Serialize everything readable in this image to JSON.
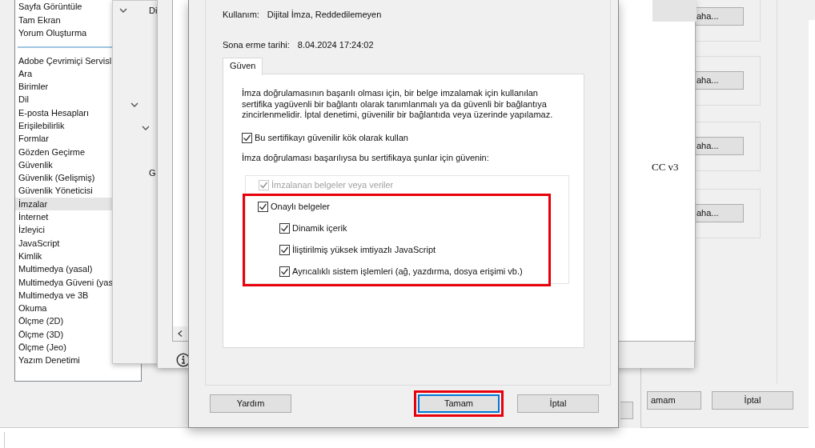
{
  "preferences_window": {
    "categories_top": [
      "Sayfa Görüntüle",
      "Tam Ekran",
      "Yorum Oluşturma"
    ],
    "categories": [
      {
        "label": "Adobe Çevrimiçi Servisl",
        "selected": false
      },
      {
        "label": "Ara",
        "selected": false
      },
      {
        "label": "Birimler",
        "selected": false
      },
      {
        "label": "Dil",
        "selected": false
      },
      {
        "label": "E-posta Hesapları",
        "selected": false
      },
      {
        "label": "Erişilebilirlik",
        "selected": false
      },
      {
        "label": "Formlar",
        "selected": false
      },
      {
        "label": "Gözden Geçirme",
        "selected": false
      },
      {
        "label": "Güvenlik",
        "selected": false
      },
      {
        "label": "Güvenlik (Gelişmiş)",
        "selected": false
      },
      {
        "label": "Güvenlik Yöneticisi",
        "selected": false
      },
      {
        "label": "İmzalar",
        "selected": true
      },
      {
        "label": "İnternet",
        "selected": false
      },
      {
        "label": "İzleyici",
        "selected": false
      },
      {
        "label": "JavaScript",
        "selected": false
      },
      {
        "label": "Kimlik",
        "selected": false
      },
      {
        "label": "Multimedya (yasal)",
        "selected": false
      },
      {
        "label": "Multimedya Güveni (yas",
        "selected": false
      },
      {
        "label": "Multimedya ve 3B",
        "selected": false
      },
      {
        "label": "Okuma",
        "selected": false
      },
      {
        "label": "Ölçme (2D)",
        "selected": false
      },
      {
        "label": "Ölçme (3D)",
        "selected": false
      },
      {
        "label": "Ölçme (Jeo)",
        "selected": false
      },
      {
        "label": "Yazım Denetimi",
        "selected": false
      }
    ],
    "more_buttons": [
      "aha...",
      "aha...",
      "aha...",
      "aha..."
    ],
    "buttons": [
      "amam",
      "İptal"
    ]
  },
  "signatures_window": {
    "labels": [
      "Di",
      "G"
    ]
  },
  "certificates_window": {
    "list_text": "CC v3"
  },
  "dialog": {
    "usage_label": "Kullanım:",
    "usage_value": "Dijital İmza, Reddedilemeyen",
    "expiry_label": "Sona erme tarihi:",
    "expiry_value": "8.04.2024 17:24:02",
    "tabs": [
      {
        "label": "Güven",
        "selected": true
      }
    ],
    "description": "İmza doğrulamasının başarılı olması için, bir belge imzalamak için kullanılan sertifika yagüvenli bir bağlantı olarak tanımlanmalı ya da güvenli bir bağlantıya zincirlenmelidir. İptal denetimi, güvenilir bir bağlantıda veya üzerinde yapılamaz.",
    "use_as_root": {
      "label": "Bu sertifikayı güvenilir kök olarak kullan",
      "checked": true
    },
    "trust_heading": "İmza doğrulaması başarılıysa bu sertifikaya şunlar için güvenin:",
    "trust_items": [
      {
        "label": "İmzalanan belgeler veya veriler",
        "checked": true,
        "disabled": true,
        "highlighted": false
      },
      {
        "label": "Onaylı belgeler",
        "checked": true,
        "disabled": false,
        "highlighted": true,
        "children": [
          {
            "label": "Dinamik içerik",
            "checked": true,
            "disabled": false
          },
          {
            "label": "İliştirilmiş yüksek imtiyazlı JavaScript",
            "checked": true,
            "disabled": false
          },
          {
            "label": "Ayrıcalıklı sistem işlemleri (ağ, yazdırma, dosya erişimi vb.)",
            "checked": true,
            "disabled": false
          }
        ]
      }
    ],
    "buttons": [
      {
        "label": "Yardım",
        "default": false,
        "highlighted": false
      },
      {
        "label": "Tamam",
        "default": true,
        "highlighted": true
      },
      {
        "label": "İptal",
        "default": false,
        "highlighted": false
      }
    ]
  }
}
